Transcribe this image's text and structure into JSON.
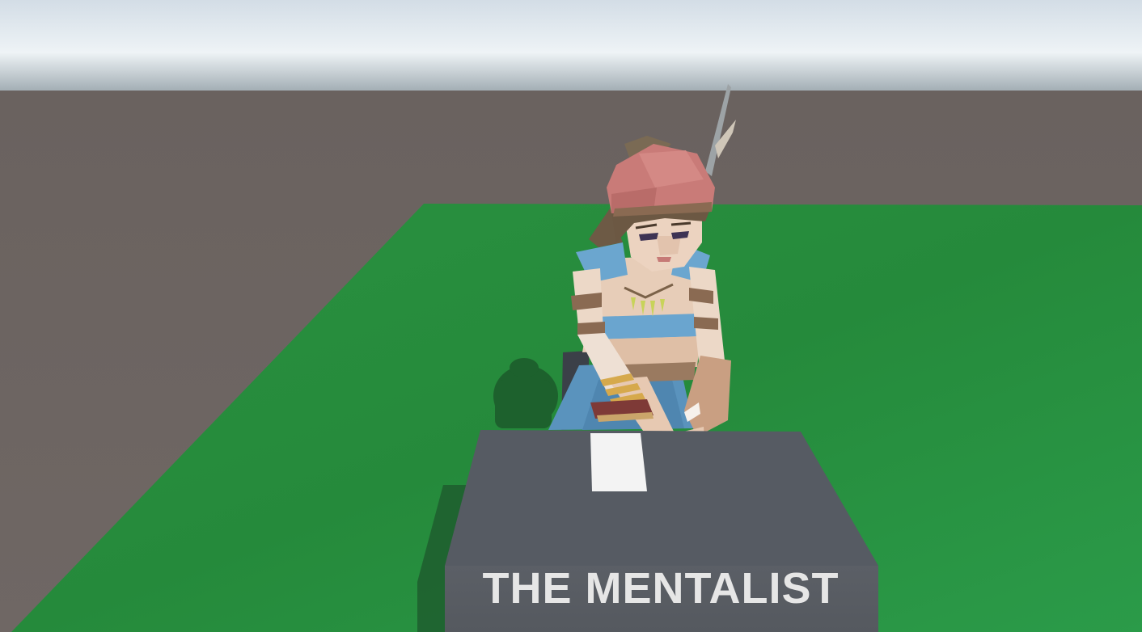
{
  "scene": {
    "title": "THE MENTALIST",
    "colors": {
      "sky_top": "#dfe7ee",
      "sky_horizon": "#f4f7f9",
      "ground": "#6e6663",
      "grass": "#24843a",
      "table_top": "#565b63",
      "table_front": "#5f6369",
      "card": "#f2f2f2",
      "hat": "#c97b78",
      "dress": "#5b98c4",
      "skin": "#e9cdb8",
      "title_text": "#e6e6e6"
    }
  }
}
